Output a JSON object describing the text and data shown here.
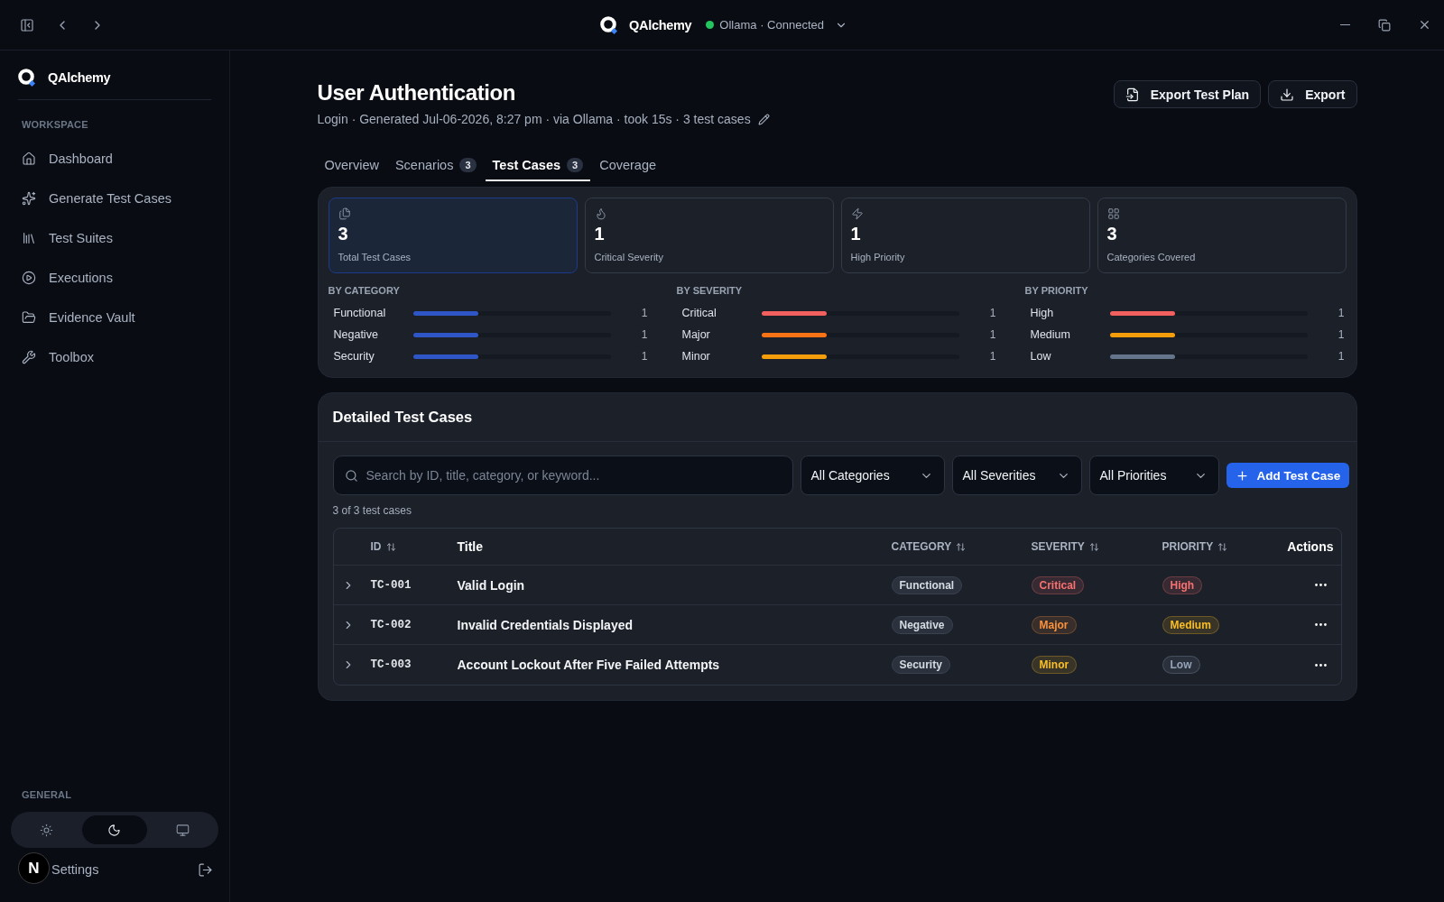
{
  "top_bar": {
    "app_name": "QAlchemy",
    "connection": {
      "label": "Ollama · Connected",
      "color": "#22c55e"
    }
  },
  "sidebar": {
    "app_name": "QAlchemy",
    "section_title": "WORKSPACE",
    "items": [
      {
        "label": "Dashboard"
      },
      {
        "label": "Generate Test Cases"
      },
      {
        "label": "Test Suites"
      },
      {
        "label": "Executions"
      },
      {
        "label": "Evidence Vault"
      },
      {
        "label": "Toolbox"
      }
    ],
    "general_title": "GENERAL",
    "theme_options": [
      {
        "kind": "light",
        "selected": false
      },
      {
        "kind": "dark",
        "selected": true
      },
      {
        "kind": "system",
        "selected": false
      }
    ],
    "settings_label": "Settings"
  },
  "dev_badge": {
    "label": "N"
  },
  "page": {
    "title": "User Authentication",
    "subtitle": "Login · Generated Jul-06-2026, 8:27 pm · via Ollama · took 15s · 3 test cases",
    "actions": [
      "Export Test Plan",
      "Export"
    ]
  },
  "tabs": [
    {
      "label": "Overview",
      "selected": false
    },
    {
      "label": "Scenarios",
      "count": "3",
      "selected": false
    },
    {
      "label": "Test Cases",
      "count": "3",
      "selected": true
    },
    {
      "label": "Coverage",
      "selected": false
    }
  ],
  "stats": [
    {
      "value": "3",
      "label": "Total Test Cases",
      "selected": true
    },
    {
      "value": "1",
      "label": "Critical Severity",
      "selected": false
    },
    {
      "value": "1",
      "label": "High Priority",
      "selected": false
    },
    {
      "value": "3",
      "label": "Categories Covered",
      "selected": false
    }
  ],
  "breakdowns": [
    {
      "title": "BY CATEGORY",
      "rows": [
        {
          "label": "Functional",
          "level": 0.33,
          "count": "1",
          "color": "#2f56c6"
        },
        {
          "label": "Negative",
          "level": 0.33,
          "count": "1",
          "color": "#2f56c6"
        },
        {
          "label": "Security",
          "level": 0.33,
          "count": "1",
          "color": "#2f56c6"
        }
      ]
    },
    {
      "title": "BY SEVERITY",
      "rows": [
        {
          "label": "Critical",
          "level": 0.33,
          "count": "1",
          "color": "#f25f5f"
        },
        {
          "label": "Major",
          "level": 0.33,
          "count": "1",
          "color": "#f97316"
        },
        {
          "label": "Minor",
          "level": 0.33,
          "count": "1",
          "color": "#f59e0b"
        }
      ]
    },
    {
      "title": "BY PRIORITY",
      "rows": [
        {
          "label": "High",
          "level": 0.33,
          "count": "1",
          "color": "#f25f5f"
        },
        {
          "label": "Medium",
          "level": 0.33,
          "count": "1",
          "color": "#f59e0b"
        },
        {
          "label": "Low",
          "level": 0.33,
          "count": "1",
          "color": "#64748b"
        }
      ]
    }
  ],
  "test_cases": {
    "title": "Detailed Test Cases",
    "search": {
      "placeholder": "Search by ID, title, category, or keyword..."
    },
    "filters": [
      "All Categories",
      "All Severities",
      "All Priorities"
    ],
    "add_button": "Add Test Case",
    "result_count": "3 of 3 test cases",
    "table": {
      "columns": [
        {
          "label": "ID",
          "sortable": true
        },
        {
          "label": "Title",
          "sortable": false
        },
        {
          "label": "CATEGORY",
          "sortable": true
        },
        {
          "label": "SEVERITY",
          "sortable": true
        },
        {
          "label": "PRIORITY",
          "sortable": true
        },
        {
          "label": "Actions",
          "sortable": false
        }
      ],
      "rows": [
        {
          "expanded": false,
          "id": "TC-001",
          "title": "Valid Login",
          "category": "Functional",
          "severity": {
            "label": "Critical",
            "color": "#f87171"
          },
          "priority": {
            "label": "High",
            "color": "#f87171"
          }
        },
        {
          "expanded": false,
          "id": "TC-002",
          "title": "Invalid Credentials Displayed",
          "category": "Negative",
          "severity": {
            "label": "Major",
            "color": "#fb923c"
          },
          "priority": {
            "label": "Medium",
            "color": "#fbbf24"
          }
        },
        {
          "expanded": false,
          "id": "TC-003",
          "title": "Account Lockout After Five Failed Attempts",
          "category": "Security",
          "severity": {
            "label": "Minor",
            "color": "#fbbf24"
          },
          "priority": {
            "label": "Low",
            "color": "#94a3b8"
          }
        }
      ]
    }
  }
}
